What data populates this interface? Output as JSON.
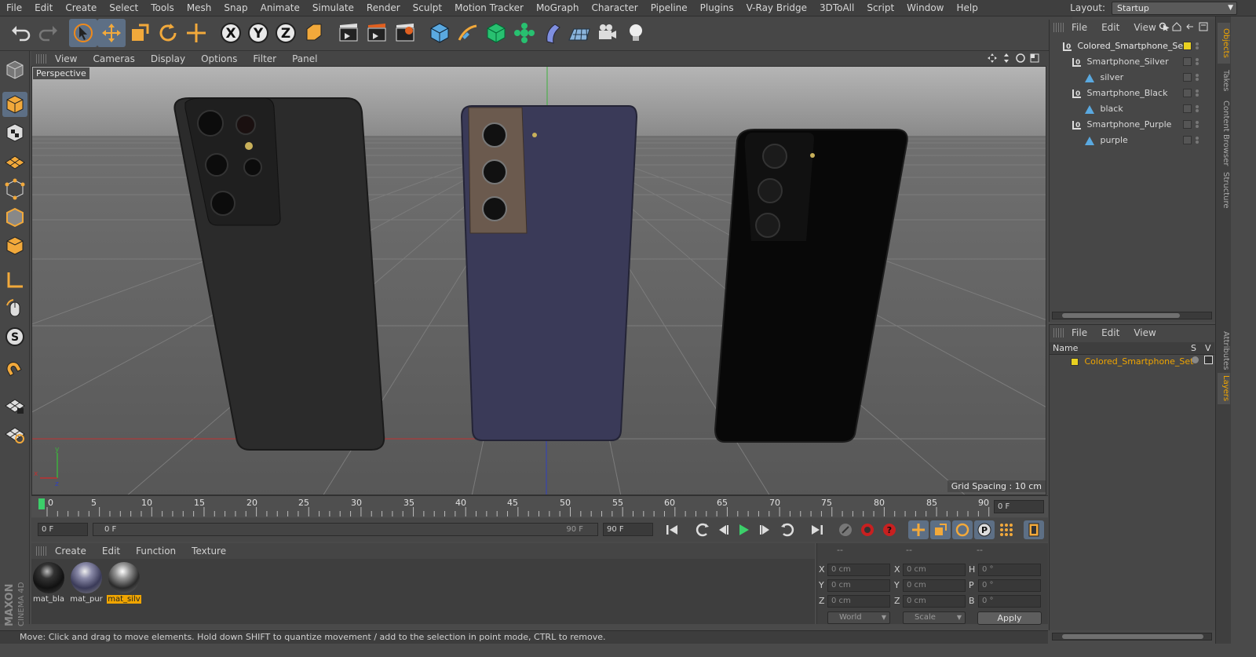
{
  "menubar": {
    "items": [
      "File",
      "Edit",
      "Create",
      "Select",
      "Tools",
      "Mesh",
      "Snap",
      "Animate",
      "Simulate",
      "Render",
      "Sculpt",
      "Motion Tracker",
      "MoGraph",
      "Character",
      "Pipeline",
      "Plugins",
      "V-Ray Bridge",
      "3DToAll",
      "Script",
      "Window",
      "Help"
    ],
    "layout_label": "Layout:",
    "layout_value": "Startup"
  },
  "viewport": {
    "menu": [
      "View",
      "Cameras",
      "Display",
      "Options",
      "Filter",
      "Panel"
    ],
    "camera_label": "Perspective",
    "grid_spacing": "Grid Spacing : 10 cm",
    "phones": [
      "silver",
      "purple",
      "black"
    ],
    "colors": {
      "silver_body": "#2b2b2b",
      "purple_body": "#3a3a58",
      "black_body": "#080808",
      "camera_bronze": "#6b5a4e"
    }
  },
  "timeline": {
    "ticks": [
      "0",
      "5",
      "10",
      "15",
      "20",
      "25",
      "30",
      "35",
      "40",
      "45",
      "50",
      "55",
      "60",
      "65",
      "70",
      "75",
      "80",
      "85",
      "90"
    ],
    "right_frame": "0 F",
    "current_frame": "0 F",
    "slider_start": "0 F",
    "slider_end": "90 F",
    "end_frame": "90 F"
  },
  "materials": {
    "menu": [
      "Create",
      "Edit",
      "Function",
      "Texture"
    ],
    "items": [
      {
        "name": "mat_bla",
        "selected": false
      },
      {
        "name": "mat_pur",
        "selected": false
      },
      {
        "name": "mat_silv",
        "selected": true
      }
    ]
  },
  "coordinates": {
    "header": [
      "--",
      "--",
      "--"
    ],
    "rows": [
      {
        "a": "X",
        "a_val": "0 cm",
        "b": "X",
        "b_val": "0 cm",
        "c": "H",
        "c_val": "0 °"
      },
      {
        "a": "Y",
        "a_val": "0 cm",
        "b": "Y",
        "b_val": "0 cm",
        "c": "P",
        "c_val": "0 °"
      },
      {
        "a": "Z",
        "a_val": "0 cm",
        "b": "Z",
        "b_val": "0 cm",
        "c": "B",
        "c_val": "0 °"
      }
    ],
    "mode": "World",
    "transform": "Scale",
    "apply": "Apply"
  },
  "status": "Move: Click and drag to move elements. Hold down SHIFT to quantize movement / add to the selection in point mode, CTRL to remove.",
  "objects": {
    "menu": [
      "File",
      "Edit",
      "View"
    ],
    "items": [
      {
        "name": "Colored_Smartphone_Set",
        "type": "null"
      },
      {
        "name": "Smartphone_Silver",
        "type": "null"
      },
      {
        "name": "silver",
        "type": "mesh"
      },
      {
        "name": "Smartphone_Black",
        "type": "null"
      },
      {
        "name": "black",
        "type": "mesh"
      },
      {
        "name": "Smartphone_Purple",
        "type": "null"
      },
      {
        "name": "purple",
        "type": "mesh"
      }
    ]
  },
  "layers": {
    "menu": [
      "File",
      "Edit",
      "View"
    ],
    "col_name": "Name",
    "col_s": "S",
    "col_v": "V",
    "items": [
      "Colored_Smartphone_Set"
    ]
  },
  "side_tabs": [
    "Objects",
    "Takes",
    "Content Browser",
    "Structure",
    "Attributes",
    "Layers"
  ],
  "logo": {
    "brand": "MAXON",
    "product": "CINEMA 4D"
  }
}
